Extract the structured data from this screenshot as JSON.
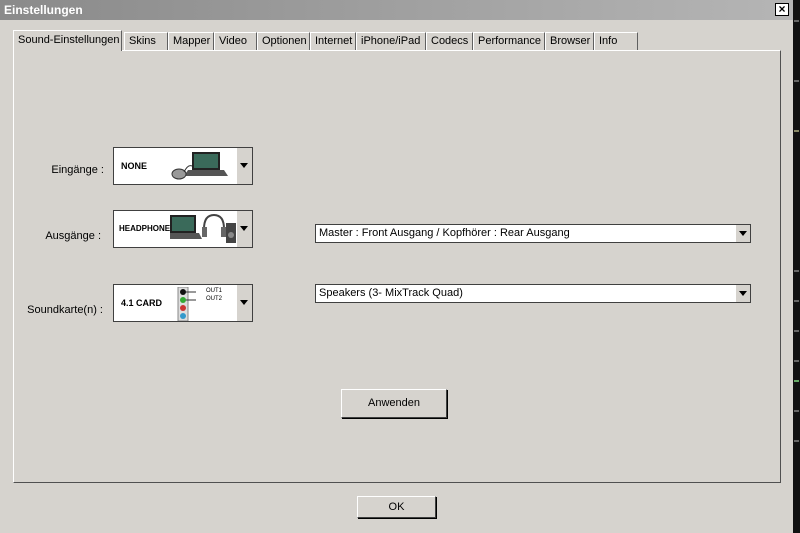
{
  "window": {
    "title": "Einstellungen",
    "close_label": "×"
  },
  "tabs": [
    {
      "label": "Sound-Einstellungen",
      "active": true
    },
    {
      "label": "Skins"
    },
    {
      "label": "Mapper"
    },
    {
      "label": "Video"
    },
    {
      "label": "Optionen"
    },
    {
      "label": "Internet"
    },
    {
      "label": "iPhone/iPad"
    },
    {
      "label": "Codecs"
    },
    {
      "label": "Performance"
    },
    {
      "label": "Browser"
    },
    {
      "label": "Info"
    }
  ],
  "inputs": {
    "label": "Eingänge :",
    "selected": "NONE",
    "icon": "laptop-turntable-icon"
  },
  "outputs": {
    "label": "Ausgänge :",
    "selected": "HEADPHONES",
    "icon": "laptop-headphones-icon",
    "routing": "Master : Front Ausgang / Kopfhörer : Rear Ausgang"
  },
  "soundcard": {
    "label": "Soundkarte(n) :",
    "selected": "4.1 CARD",
    "icon": "jack-outputs-icon",
    "out1": "OUT1",
    "out2": "OUT2",
    "device": "Speakers (3- MixTrack Quad)"
  },
  "buttons": {
    "apply": "Anwenden",
    "ok": "OK"
  },
  "colors": {
    "dialog": "#d6d3ce",
    "title_bar": "#9c9c9c"
  }
}
